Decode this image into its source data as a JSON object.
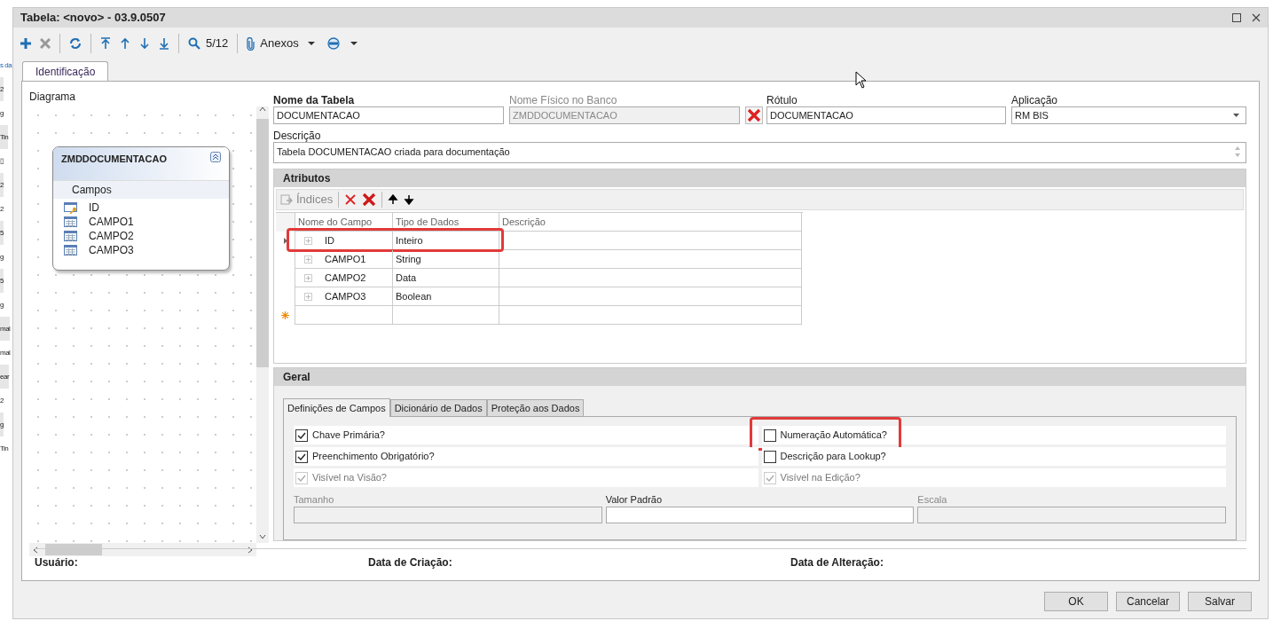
{
  "background_cells": [
    "s da",
    "2",
    "g",
    "Tin",
    "▯",
    "2",
    "2",
    "5",
    "g",
    "5",
    "g",
    "mal",
    "mal",
    "ear",
    "2",
    "g",
    "Tin"
  ],
  "window": {
    "title": "Tabela: <novo> - 03.9.0507"
  },
  "toolbar": {
    "record_counter": "5/12",
    "attachments_label": "Anexos"
  },
  "tabs": [
    {
      "label": "Identificação",
      "selected": true
    }
  ],
  "diagram": {
    "label": "Diagrama",
    "entity": {
      "title": "ZMDDOCUMENTACAO",
      "section": "Campos",
      "fields": [
        {
          "name": "ID",
          "key": true
        },
        {
          "name": "CAMPO1",
          "key": false
        },
        {
          "name": "CAMPO2",
          "key": false
        },
        {
          "name": "CAMPO3",
          "key": false
        }
      ]
    }
  },
  "form": {
    "table_name": {
      "label": "Nome da Tabela",
      "value": "DOCUMENTACAO"
    },
    "physical_name": {
      "label": "Nome Físico no Banco",
      "value": "ZMDDOCUMENTACAO",
      "disabled": true
    },
    "caption": {
      "label": "Rótulo",
      "value": "DOCUMENTACAO"
    },
    "application": {
      "label": "Aplicação",
      "value": "RM BIS"
    },
    "description": {
      "label": "Descrição",
      "value": "Tabela DOCUMENTACAO criada para documentação"
    }
  },
  "attributes": {
    "title": "Atributos",
    "indices_label": "Índices",
    "columns": [
      "Nome do Campo",
      "Tipo de Dados",
      "Descrição"
    ],
    "rows": [
      {
        "name": "ID",
        "type": "Inteiro",
        "current": true,
        "highlighted": true
      },
      {
        "name": "CAMPO1",
        "type": "String",
        "current": false,
        "highlighted": false
      },
      {
        "name": "CAMPO2",
        "type": "Data",
        "current": false,
        "highlighted": false
      },
      {
        "name": "CAMPO3",
        "type": "Boolean",
        "current": false,
        "highlighted": false
      }
    ]
  },
  "general": {
    "title": "Geral",
    "tabs": [
      {
        "label": "Definições de Campos",
        "selected": true
      },
      {
        "label": "Dicionário de Dados",
        "selected": false
      },
      {
        "label": "Proteção aos Dados",
        "selected": false
      }
    ],
    "checkboxes": [
      {
        "label": "Chave Primária?",
        "checked": true,
        "disabled": false,
        "highlighted": false
      },
      {
        "label": "Numeração Automática?",
        "checked": false,
        "disabled": false,
        "highlighted": true
      },
      {
        "label": "Preenchimento Obrigatório?",
        "checked": true,
        "disabled": false,
        "highlighted": false
      },
      {
        "label": "Descrição para Lookup?",
        "checked": false,
        "disabled": false,
        "highlighted": false
      },
      {
        "label": "Visível na Visão?",
        "checked": true,
        "disabled": true,
        "highlighted": false
      },
      {
        "label": "Visível na Edição?",
        "checked": true,
        "disabled": true,
        "highlighted": false
      }
    ],
    "inputs": [
      {
        "label": "Tamanho",
        "disabled": true
      },
      {
        "label": "Valor Padrão",
        "disabled": false
      },
      {
        "label": "Escala",
        "disabled": true
      }
    ]
  },
  "footer": [
    "Usuário:",
    "Data de Criação:",
    "Data de Alteração:"
  ],
  "buttons": [
    "OK",
    "Cancelar",
    "Salvar"
  ]
}
